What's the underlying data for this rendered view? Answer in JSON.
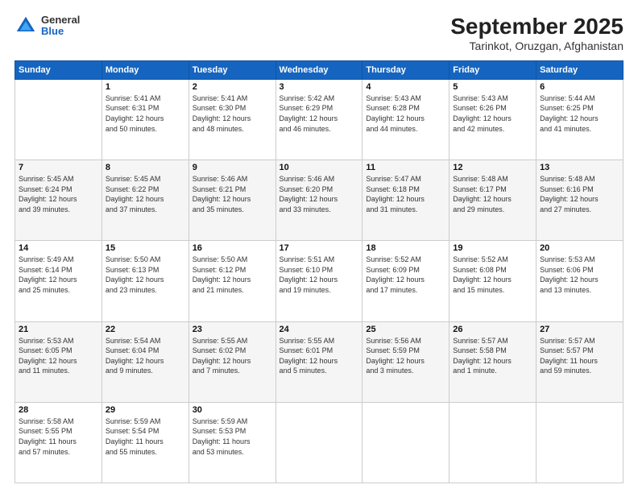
{
  "header": {
    "logo": {
      "general": "General",
      "blue": "Blue"
    },
    "title": "September 2025",
    "subtitle": "Tarinkot, Oruzgan, Afghanistan"
  },
  "calendar": {
    "days_header": [
      "Sunday",
      "Monday",
      "Tuesday",
      "Wednesday",
      "Thursday",
      "Friday",
      "Saturday"
    ],
    "weeks": [
      [
        {
          "day": "",
          "info": ""
        },
        {
          "day": "1",
          "info": "Sunrise: 5:41 AM\nSunset: 6:31 PM\nDaylight: 12 hours\nand 50 minutes."
        },
        {
          "day": "2",
          "info": "Sunrise: 5:41 AM\nSunset: 6:30 PM\nDaylight: 12 hours\nand 48 minutes."
        },
        {
          "day": "3",
          "info": "Sunrise: 5:42 AM\nSunset: 6:29 PM\nDaylight: 12 hours\nand 46 minutes."
        },
        {
          "day": "4",
          "info": "Sunrise: 5:43 AM\nSunset: 6:28 PM\nDaylight: 12 hours\nand 44 minutes."
        },
        {
          "day": "5",
          "info": "Sunrise: 5:43 AM\nSunset: 6:26 PM\nDaylight: 12 hours\nand 42 minutes."
        },
        {
          "day": "6",
          "info": "Sunrise: 5:44 AM\nSunset: 6:25 PM\nDaylight: 12 hours\nand 41 minutes."
        }
      ],
      [
        {
          "day": "7",
          "info": "Sunrise: 5:45 AM\nSunset: 6:24 PM\nDaylight: 12 hours\nand 39 minutes."
        },
        {
          "day": "8",
          "info": "Sunrise: 5:45 AM\nSunset: 6:22 PM\nDaylight: 12 hours\nand 37 minutes."
        },
        {
          "day": "9",
          "info": "Sunrise: 5:46 AM\nSunset: 6:21 PM\nDaylight: 12 hours\nand 35 minutes."
        },
        {
          "day": "10",
          "info": "Sunrise: 5:46 AM\nSunset: 6:20 PM\nDaylight: 12 hours\nand 33 minutes."
        },
        {
          "day": "11",
          "info": "Sunrise: 5:47 AM\nSunset: 6:18 PM\nDaylight: 12 hours\nand 31 minutes."
        },
        {
          "day": "12",
          "info": "Sunrise: 5:48 AM\nSunset: 6:17 PM\nDaylight: 12 hours\nand 29 minutes."
        },
        {
          "day": "13",
          "info": "Sunrise: 5:48 AM\nSunset: 6:16 PM\nDaylight: 12 hours\nand 27 minutes."
        }
      ],
      [
        {
          "day": "14",
          "info": "Sunrise: 5:49 AM\nSunset: 6:14 PM\nDaylight: 12 hours\nand 25 minutes."
        },
        {
          "day": "15",
          "info": "Sunrise: 5:50 AM\nSunset: 6:13 PM\nDaylight: 12 hours\nand 23 minutes."
        },
        {
          "day": "16",
          "info": "Sunrise: 5:50 AM\nSunset: 6:12 PM\nDaylight: 12 hours\nand 21 minutes."
        },
        {
          "day": "17",
          "info": "Sunrise: 5:51 AM\nSunset: 6:10 PM\nDaylight: 12 hours\nand 19 minutes."
        },
        {
          "day": "18",
          "info": "Sunrise: 5:52 AM\nSunset: 6:09 PM\nDaylight: 12 hours\nand 17 minutes."
        },
        {
          "day": "19",
          "info": "Sunrise: 5:52 AM\nSunset: 6:08 PM\nDaylight: 12 hours\nand 15 minutes."
        },
        {
          "day": "20",
          "info": "Sunrise: 5:53 AM\nSunset: 6:06 PM\nDaylight: 12 hours\nand 13 minutes."
        }
      ],
      [
        {
          "day": "21",
          "info": "Sunrise: 5:53 AM\nSunset: 6:05 PM\nDaylight: 12 hours\nand 11 minutes."
        },
        {
          "day": "22",
          "info": "Sunrise: 5:54 AM\nSunset: 6:04 PM\nDaylight: 12 hours\nand 9 minutes."
        },
        {
          "day": "23",
          "info": "Sunrise: 5:55 AM\nSunset: 6:02 PM\nDaylight: 12 hours\nand 7 minutes."
        },
        {
          "day": "24",
          "info": "Sunrise: 5:55 AM\nSunset: 6:01 PM\nDaylight: 12 hours\nand 5 minutes."
        },
        {
          "day": "25",
          "info": "Sunrise: 5:56 AM\nSunset: 5:59 PM\nDaylight: 12 hours\nand 3 minutes."
        },
        {
          "day": "26",
          "info": "Sunrise: 5:57 AM\nSunset: 5:58 PM\nDaylight: 12 hours\nand 1 minute."
        },
        {
          "day": "27",
          "info": "Sunrise: 5:57 AM\nSunset: 5:57 PM\nDaylight: 11 hours\nand 59 minutes."
        }
      ],
      [
        {
          "day": "28",
          "info": "Sunrise: 5:58 AM\nSunset: 5:55 PM\nDaylight: 11 hours\nand 57 minutes."
        },
        {
          "day": "29",
          "info": "Sunrise: 5:59 AM\nSunset: 5:54 PM\nDaylight: 11 hours\nand 55 minutes."
        },
        {
          "day": "30",
          "info": "Sunrise: 5:59 AM\nSunset: 5:53 PM\nDaylight: 11 hours\nand 53 minutes."
        },
        {
          "day": "",
          "info": ""
        },
        {
          "day": "",
          "info": ""
        },
        {
          "day": "",
          "info": ""
        },
        {
          "day": "",
          "info": ""
        }
      ]
    ]
  }
}
